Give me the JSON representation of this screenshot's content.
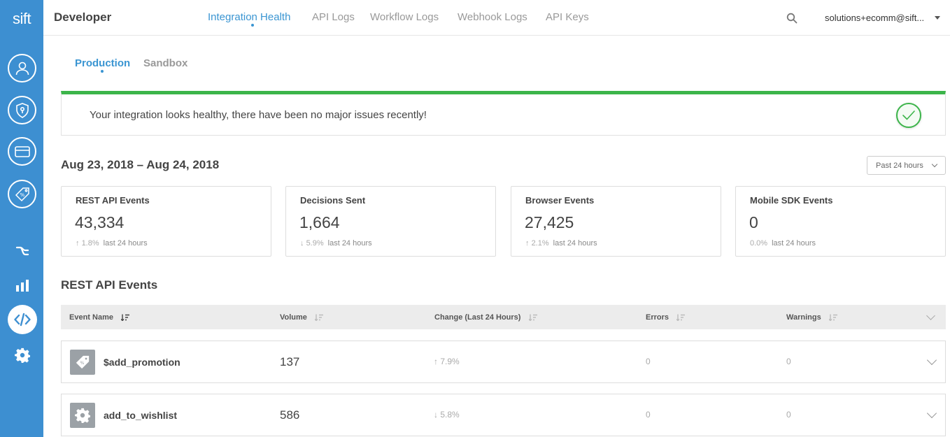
{
  "sidebar": {
    "logo": "sift",
    "items": [
      {
        "icon": "user-icon"
      },
      {
        "icon": "shield-icon"
      },
      {
        "icon": "credit-card-icon"
      },
      {
        "icon": "promotion-tag-icon"
      },
      {
        "icon": "workflow-icon"
      },
      {
        "icon": "bar-chart-icon"
      },
      {
        "icon": "code-icon",
        "active": true
      },
      {
        "icon": "gear-icon"
      }
    ]
  },
  "header": {
    "title": "Developer",
    "tabs": [
      {
        "label": "Integration Health",
        "active": true
      },
      {
        "label": "API Logs"
      },
      {
        "label": "Workflow Logs"
      },
      {
        "label": "Webhook Logs"
      },
      {
        "label": "API Keys"
      }
    ],
    "user": "solutions+ecomm@sift..."
  },
  "environments": [
    {
      "label": "Production",
      "active": true
    },
    {
      "label": "Sandbox"
    }
  ],
  "banner": {
    "message": "Your integration looks healthy, there have been no major issues recently!",
    "status_color": "#3cb54a"
  },
  "date_range": "Aug 23, 2018 – Aug 24, 2018",
  "period_select": "Past 24 hours",
  "stats": [
    {
      "title": "REST API Events",
      "value": "43,334",
      "arrow": "↑",
      "change": "1.8%",
      "period": "last 24 hours"
    },
    {
      "title": "Decisions Sent",
      "value": "1,664",
      "arrow": "↓",
      "change": "5.9%",
      "period": "last 24 hours"
    },
    {
      "title": "Browser Events",
      "value": "27,425",
      "arrow": "↑",
      "change": "2.1%",
      "period": "last 24 hours"
    },
    {
      "title": "Mobile SDK Events",
      "value": "0",
      "arrow": "",
      "change": "0.0%",
      "period": "last 24 hours"
    }
  ],
  "events_table": {
    "title": "REST API Events",
    "columns": [
      "Event Name",
      "Volume",
      "Change (Last 24 Hours)",
      "Errors",
      "Warnings"
    ],
    "rows": [
      {
        "icon": "promotion-tag-icon",
        "name": "$add_promotion",
        "volume": "137",
        "change": "↑ 7.9%",
        "errors": "0",
        "warnings": "0"
      },
      {
        "icon": "gear-icon",
        "name": "add_to_wishlist",
        "volume": "586",
        "change": "↓ 5.8%",
        "errors": "0",
        "warnings": "0"
      }
    ]
  },
  "colors": {
    "sidebar": "#3d8fd1",
    "accent": "#3a95d2",
    "healthy": "#3cb54a"
  }
}
